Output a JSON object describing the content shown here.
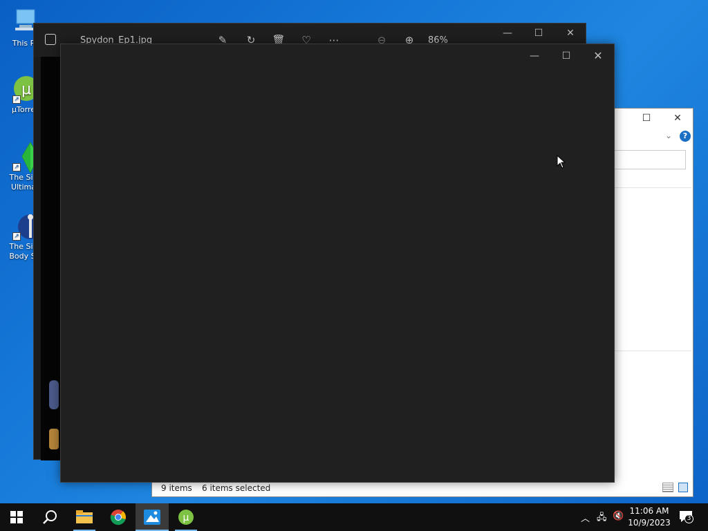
{
  "desktop": {
    "icons": [
      {
        "label_line1": "This P"
      },
      {
        "label_line1": "μTorre"
      },
      {
        "label_line1": "The Sin",
        "label_line2": "Ultima"
      },
      {
        "label_line1": "The Sin",
        "label_line2": "Body Sl"
      }
    ]
  },
  "photos_window": {
    "title": "Spydon_Ep1.jpg",
    "zoom": "86%",
    "minimize": "—",
    "maximize": "☐",
    "close": "✕"
  },
  "front_window": {
    "minimize": "—",
    "maximize": "☐",
    "close": "✕"
  },
  "explorer_window": {
    "maximize": "☐",
    "close": "✕",
    "items_count": "9 items",
    "selected_count": "6 items selected",
    "help_icon": "?"
  },
  "taskbar": {
    "apps": [
      "start",
      "search",
      "file-explorer",
      "chrome",
      "photos",
      "utorrent"
    ],
    "time": "11:06 AM",
    "date": "10/9/2023",
    "notification_count": "3"
  },
  "colors": {
    "desktop_blue": "#1679d9",
    "window_dark": "#202020",
    "taskbar": "#101010",
    "accent": "#76b9ed"
  }
}
